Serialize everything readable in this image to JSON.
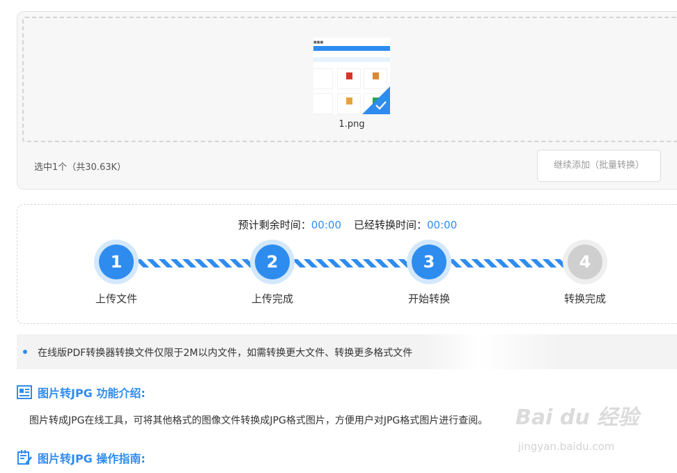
{
  "upload": {
    "file_name": "1.png",
    "selection_info": "选中1个（共30.63K）",
    "add_more_label": "继续添加（批量转换）"
  },
  "progress": {
    "remaining_label": "预计剩余时间：",
    "remaining_value": "00:00",
    "elapsed_label": "已经转换时间：",
    "elapsed_value": "00:00",
    "steps": [
      {
        "number": "1",
        "label": "上传文件",
        "state": "active"
      },
      {
        "number": "2",
        "label": "上传完成",
        "state": "active"
      },
      {
        "number": "3",
        "label": "开始转换",
        "state": "active"
      },
      {
        "number": "4",
        "label": "转换完成",
        "state": "inactive"
      }
    ]
  },
  "notice": {
    "text": "在线版PDF转换器转换文件仅限于2M以内文件，如需转换更大文件、转换更多格式文件"
  },
  "sections": {
    "intro_title": "图片转JPG 功能介绍:",
    "intro_body": "图片转成JPG在线工具，可将其他格式的图像文件转换成JPG格式图片，方便用户对JPG格式图片进行查阅。",
    "guide_title": "图片转JPG 操作指南:"
  },
  "watermark": {
    "main": "Bai du 经验",
    "sub": "jingyan.baidu.com"
  },
  "colors": {
    "accent": "#2f8cef",
    "inactive": "#cfcfcf"
  },
  "icons": {
    "intro": "article-icon",
    "guide": "edit-note-icon",
    "thumb_check": "check-icon"
  }
}
